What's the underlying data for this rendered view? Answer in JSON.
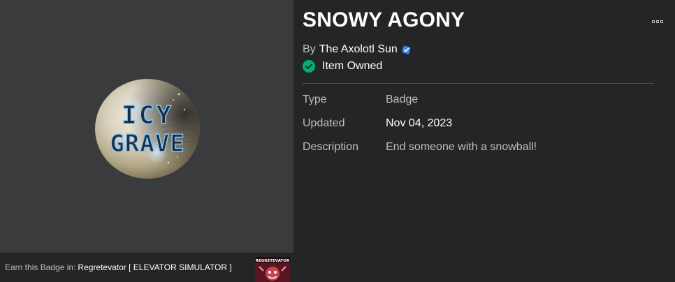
{
  "item": {
    "title": "SNOWY AGONY",
    "by_prefix": "By",
    "creator": "The Axolotl Sun",
    "owned_label": "Item Owned"
  },
  "details": {
    "type_label": "Type",
    "type_value": "Badge",
    "updated_label": "Updated",
    "updated_value": "Nov 04, 2023",
    "description_label": "Description",
    "description_value": "End someone with a snowball!"
  },
  "badge_art": {
    "line1": "ICY",
    "line2": "GRAVE"
  },
  "earn": {
    "prefix": "Earn this Badge in:",
    "game_name": "Regretevator [ ELEVATOR SIMULATOR ]",
    "game_icon_text": "REGRETEVATOR"
  },
  "icons": {
    "verified": "verified-badge-icon",
    "owned": "checkmark-circle-icon",
    "more": "more-options-icon"
  },
  "colors": {
    "background": "#232527",
    "thumbnail_bg": "#393b3d",
    "owned_green": "#00b06f",
    "verified_blue": "#3385ff",
    "muted_text": "#bdbebe"
  }
}
